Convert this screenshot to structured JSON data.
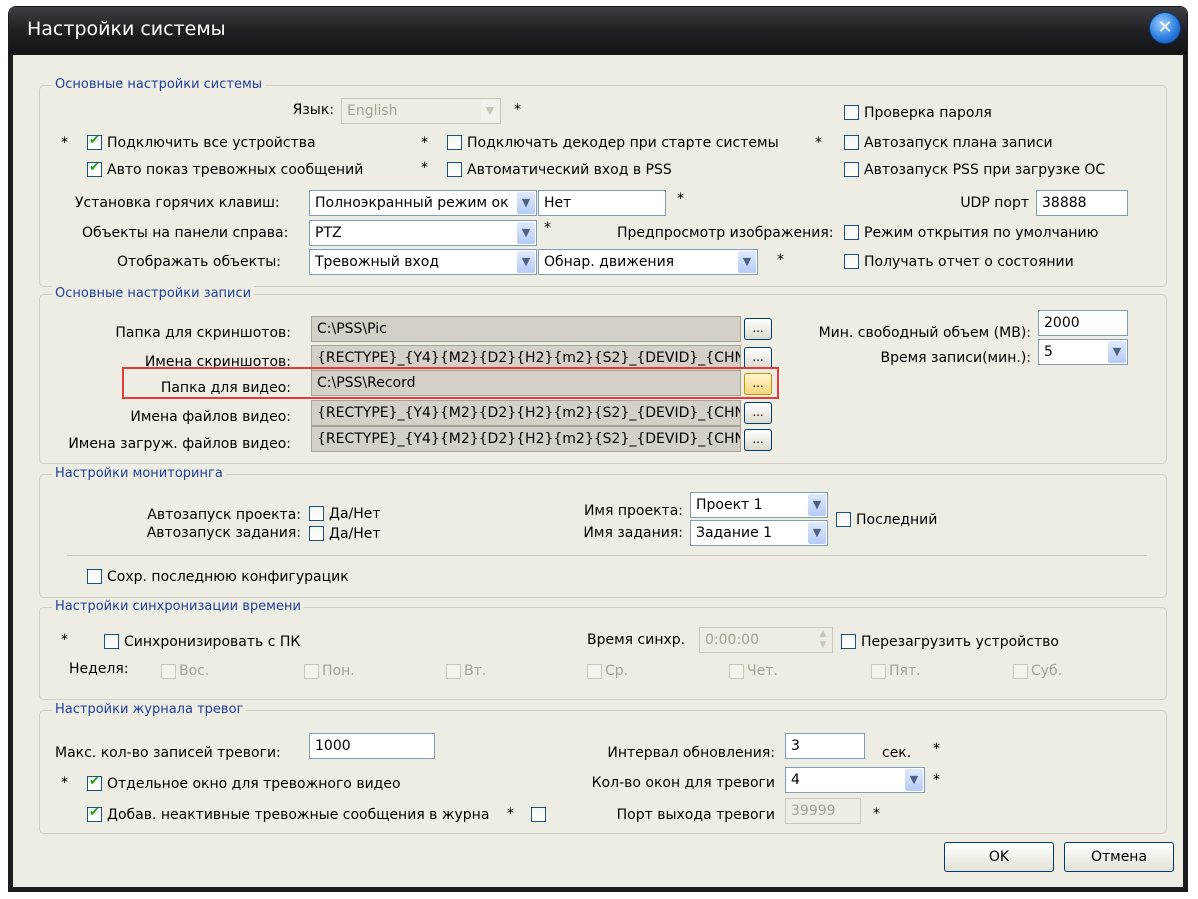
{
  "window": {
    "title": "Настройки системы",
    "close_glyph": "✕"
  },
  "g1": {
    "title": "Основные настройки системы",
    "lang_label": "Язык:",
    "lang_value": "English",
    "star": "*",
    "connect_all": "Подключить все устройства",
    "connect_decoder": "Подключать декодер при старте системы",
    "auto_show_alarm": "Авто показ тревожных сообщений",
    "auto_login": "Автоматический вход в PSS",
    "hotkey_label": "Установка горячих клавиш:",
    "hotkey_value": "Полноэкранный режим ок",
    "hotkey_key": "Нет",
    "right_panel_label": "Объекты на панели справа:",
    "right_panel_value": "PTZ",
    "preview_label": "Предпросмотр изображения:",
    "display_label": "Отображать объекты:",
    "display_value1": "Тревожный вход",
    "display_value2": "Обнар. движения",
    "check_password": "Проверка пароля",
    "autostart_plan": "Автозапуск плана записи",
    "autostart_os": "Автозапуск PSS при загрузке ОС",
    "udp_label": "UDP порт",
    "udp_value": "38888",
    "default_open": "Режим открытия по умолчанию",
    "status_report": "Получать отчет о состоянии"
  },
  "g2": {
    "title": "Основные настройки записи",
    "screens_folder_label": "Папка для скриншотов:",
    "screens_folder": "C:\\PSS\\Pic",
    "screens_names_label": "Имена скриншотов:",
    "screens_names": "{RECTYPE}_{Y4}{M2}{D2}{H2}{m2}{S2}_{DEVID}_{CHN",
    "video_folder_label": "Папка для видео:",
    "video_folder": "C:\\PSS\\Record",
    "video_names_label": "Имена файлов видео:",
    "video_names": "{RECTYPE}_{Y4}{M2}{D2}{H2}{m2}{S2}_{DEVID}_{CHN",
    "dl_names_label": "Имена загруж. файлов видео:",
    "dl_names": "{RECTYPE}_{Y4}{M2}{D2}{H2}{m2}{S2}_{DEVID}_{CHN",
    "browse": "...",
    "min_free_label": "Мин. свободный объем (MB):",
    "min_free_value": "2000",
    "rec_time_label": "Время записи(мин.):",
    "rec_time_value": "5"
  },
  "g3": {
    "title": "Настройки мониторинга",
    "autostart_project_label": "Автозапуск проекта:",
    "autostart_task_label": "Автозапуск задания:",
    "yes_no": "Да/Нет",
    "project_label": "Имя проекта:",
    "project_value": "Проект 1",
    "task_label": "Имя задания:",
    "task_value": "Задание 1",
    "last": "Последний",
    "save_last": "Сохр. последнюю конфигурацик"
  },
  "g4": {
    "title": "Настройки синхронизации времени",
    "sync_pc": "Синхронизировать с ПК",
    "sync_time_label": "Время синхр.",
    "sync_time_value": "0:00:00",
    "reboot": "Перезагрузить устройство",
    "week_label": "Неделя:",
    "days": [
      "Вос.",
      "Пон.",
      "Вт.",
      "Ср.",
      "Чет.",
      "Пят.",
      "Суб."
    ]
  },
  "g5": {
    "title": "Настройки журнала тревог",
    "max_records_label": "Макс. кол-во записей тревоги:",
    "max_records_value": "1000",
    "separate_window": "Отдельное окно для тревожного видео",
    "add_inactive": "Добав. неактивные тревожные сообщения в журна",
    "interval_label": "Интервал обновления:",
    "interval_value": "3",
    "sec": "сек.",
    "windows_label": "Кол-во окон для тревоги",
    "windows_value": "4",
    "port_label": "Порт выхода тревоги",
    "port_value": "39999"
  },
  "buttons": {
    "ok": "OK",
    "cancel": "Отмена"
  }
}
